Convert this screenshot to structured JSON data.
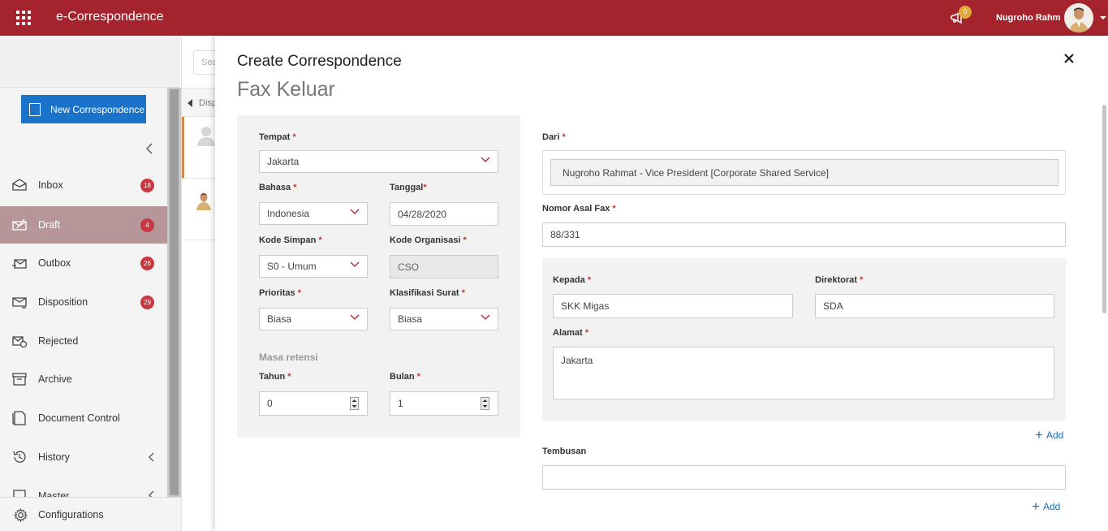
{
  "topbar": {
    "app_title": "e-Correspondence",
    "notification_count": "0",
    "user_name": "Nugroho Rahm"
  },
  "sidebar": {
    "new_button": "New Correspondence",
    "items": [
      {
        "label": "Inbox",
        "badge": "18",
        "icon": "inbox-icon"
      },
      {
        "label": "Draft",
        "badge": "4",
        "icon": "draft-icon",
        "active": true
      },
      {
        "label": "Outbox",
        "badge": "26",
        "icon": "outbox-icon"
      },
      {
        "label": "Disposition",
        "badge": "29",
        "icon": "disposition-icon"
      },
      {
        "label": "Rejected",
        "icon": "rejected-icon"
      },
      {
        "label": "Archive",
        "icon": "archive-icon"
      },
      {
        "label": "Document Control",
        "icon": "document-control-icon"
      },
      {
        "label": "History",
        "icon": "history-icon"
      },
      {
        "label": "Master",
        "icon": "master-icon"
      }
    ],
    "configurations": "Configurations"
  },
  "middle": {
    "search_placeholder": "Sea",
    "disposition_tab": "Disp"
  },
  "panel": {
    "title": "Create Correspondence",
    "subtitle": "Fax Keluar",
    "left": {
      "tempat_label": "Tempat",
      "tempat_value": "Jakarta",
      "bahasa_label": "Bahasa",
      "bahasa_value": "Indonesia",
      "tanggal_label": "Tanggal",
      "tanggal_value": "04/28/2020",
      "kode_simpan_label": "Kode Simpan",
      "kode_simpan_value": "S0 - Umum",
      "kode_organisasi_label": "Kode Organisasi",
      "kode_organisasi_value": "CSO",
      "prioritas_label": "Prioritas",
      "prioritas_value": "Biasa",
      "klasifikasi_label": "Klasifikasi Surat",
      "klasifikasi_value": "Biasa",
      "masa_retensi_label": "Masa retensi",
      "tahun_label": "Tahun",
      "tahun_value": "0",
      "bulan_label": "Bulan",
      "bulan_value": "1"
    },
    "right": {
      "dari_label": "Dari",
      "dari_value": "Nugroho Rahmat - Vice President [Corporate Shared Service]",
      "nomor_label": "Nomor Asal Fax",
      "nomor_value": "88/331",
      "kepada_label": "Kepada",
      "kepada_value": "SKK Migas",
      "direktorat_label": "Direktorat",
      "direktorat_value": "SDA",
      "alamat_label": "Alamat",
      "alamat_value": "Jakarta",
      "add_label": "Add",
      "tembusan_label": "Tembusan",
      "tembusan_value": "",
      "add2_label": "Add"
    }
  },
  "colors": {
    "brand": "#a4232d",
    "primary_button": "#1a73c8",
    "badge": "#c73840",
    "active_nav": "#b7969a"
  }
}
